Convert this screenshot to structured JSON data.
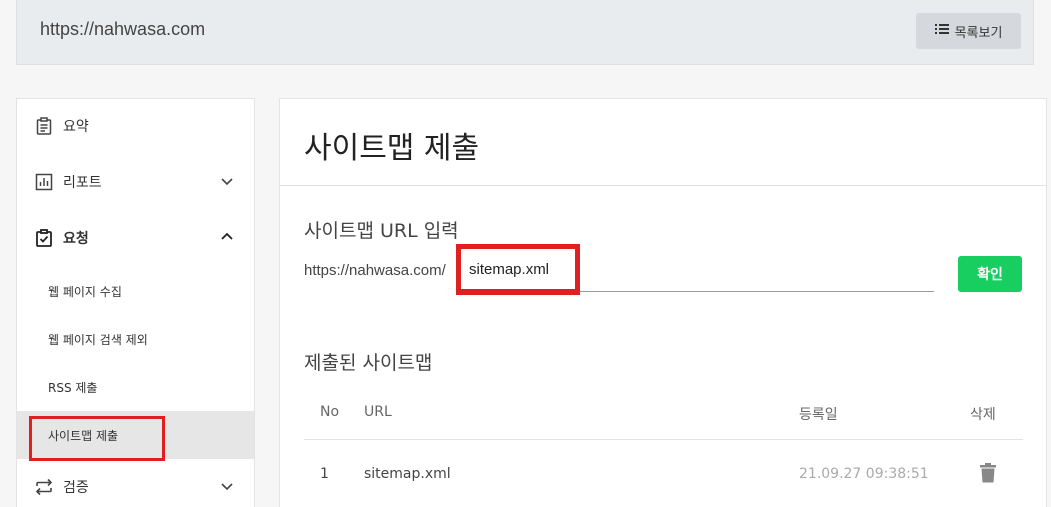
{
  "topbar": {
    "url": "https://nahwasa.com",
    "list_button": "목록보기",
    "list_icon": "list-icon"
  },
  "sidebar": {
    "summary": "요약",
    "report": "리포트",
    "request": "요청",
    "sub_items": [
      "웹 페이지 수집",
      "웹 페이지 검색 제외",
      "RSS 제출",
      "사이트맵 제출"
    ],
    "verify": "검증"
  },
  "main": {
    "title": "사이트맵 제출",
    "input_section_title": "사이트맵 URL 입력",
    "prefix": "https://nahwasa.com/",
    "input_value": "sitemap.xml",
    "confirm_label": "확인",
    "submitted_title": "제출된 사이트맵",
    "table": {
      "headers": [
        "No",
        "URL",
        "등록일",
        "삭제"
      ],
      "rows": [
        {
          "no": "1",
          "url": "sitemap.xml",
          "date": "21.09.27 09:38:51"
        }
      ]
    }
  },
  "colors": {
    "accent": "#19ce60",
    "highlight": "#e02020"
  }
}
